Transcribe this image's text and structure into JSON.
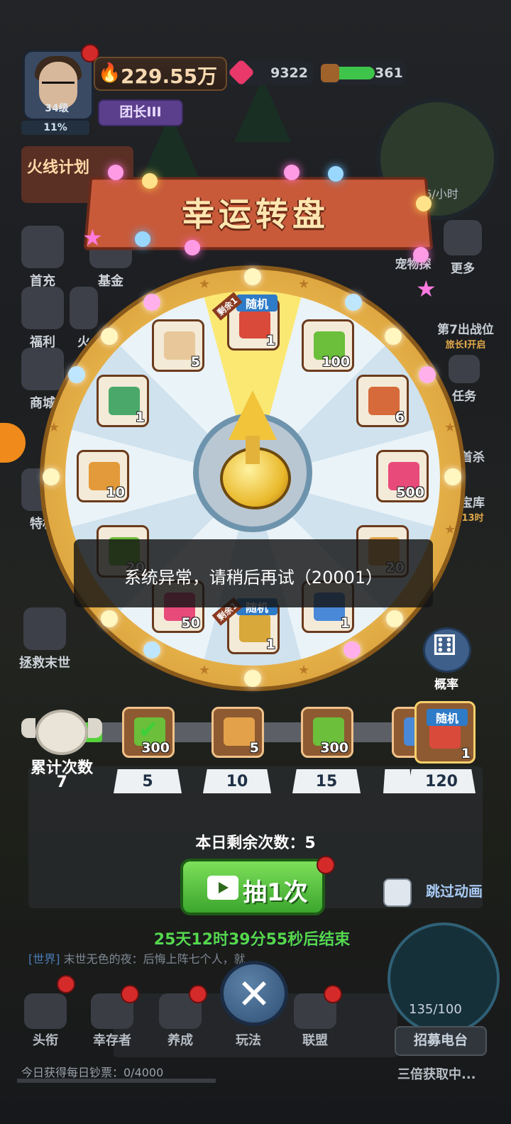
{
  "top": {
    "level": "34级",
    "exp_percent": "11%",
    "power": "229.55万",
    "gems": "9322",
    "wood": "361",
    "title_badge": "团长III",
    "plan": "火线计划",
    "rate": "76/小时"
  },
  "left_menu": [
    "首充",
    "基金",
    "福利",
    "商城",
    "特权",
    "拯救末世"
  ],
  "left_menu_partial": [
    "火",
    "烧"
  ],
  "right_menu": [
    "更多",
    "宠物探",
    "第7出战位",
    "旅长I开启",
    "任务",
    "首杀",
    "宝库",
    "13时"
  ],
  "banner": {
    "title": "幸运转盘"
  },
  "wheel": {
    "remain_tag": "剩余1",
    "random_tag": "随机",
    "prizes": [
      {
        "name": "random-chest-top",
        "count": "1",
        "color": "#d94a3a"
      },
      {
        "name": "cash",
        "count": "100",
        "color": "#6bbf3a"
      },
      {
        "name": "potion",
        "count": "6",
        "color": "#d66a3a"
      },
      {
        "name": "ruby",
        "count": "500",
        "color": "#e84a7a"
      },
      {
        "name": "coupon-right",
        "count": "20",
        "color": "#e3a24a"
      },
      {
        "name": "blue-ticket",
        "count": "1",
        "color": "#4a88d8"
      },
      {
        "name": "random-chest-bottom",
        "count": "1",
        "color": "#d8a83a"
      },
      {
        "name": "ruby-small",
        "count": "50",
        "color": "#e84a7a"
      },
      {
        "name": "cash-left",
        "count": "20",
        "color": "#6bbf3a"
      },
      {
        "name": "ticket",
        "count": "10",
        "color": "#e39a3a"
      },
      {
        "name": "compass",
        "count": "1",
        "color": "#4aa86a"
      },
      {
        "name": "pet-food",
        "count": "5",
        "color": "#e8c89a"
      }
    ]
  },
  "toast": "系统异常，请稍后再试（20001）",
  "probability_label": "概率",
  "progress": {
    "label": "累计次数",
    "count": "7",
    "fill_fraction": 0.06,
    "milestones": [
      {
        "threshold": "5",
        "count": "300",
        "claimed": true,
        "color": "#6bbf3a"
      },
      {
        "threshold": "10",
        "count": "5",
        "claimed": false,
        "color": "#e3a24a"
      },
      {
        "threshold": "15",
        "count": "300",
        "claimed": false,
        "color": "#6bbf3a"
      },
      {
        "threshold": "",
        "count": "",
        "claimed": false,
        "color": "#4a88d8"
      },
      {
        "threshold": "120",
        "count": "1",
        "claimed": false,
        "color": "#d94a3a",
        "tag": "随机"
      }
    ]
  },
  "remaining_today": "本日剩余次数：5",
  "draw_button": "抽1次",
  "skip_label": "跳过动画",
  "countdown": "25天12时39分55秒后结束",
  "chat": {
    "channel": "[世界]",
    "text": "末世无色的夜：后悔上阵七个人，就"
  },
  "radar_count": "135/100",
  "radio_button": "招募电台",
  "nav": [
    "头衔",
    "幸存者",
    "养成",
    "玩法",
    "联盟"
  ],
  "daily_gain": "今日获得每日钞票：0/4000",
  "double_label": "三倍获取中..."
}
